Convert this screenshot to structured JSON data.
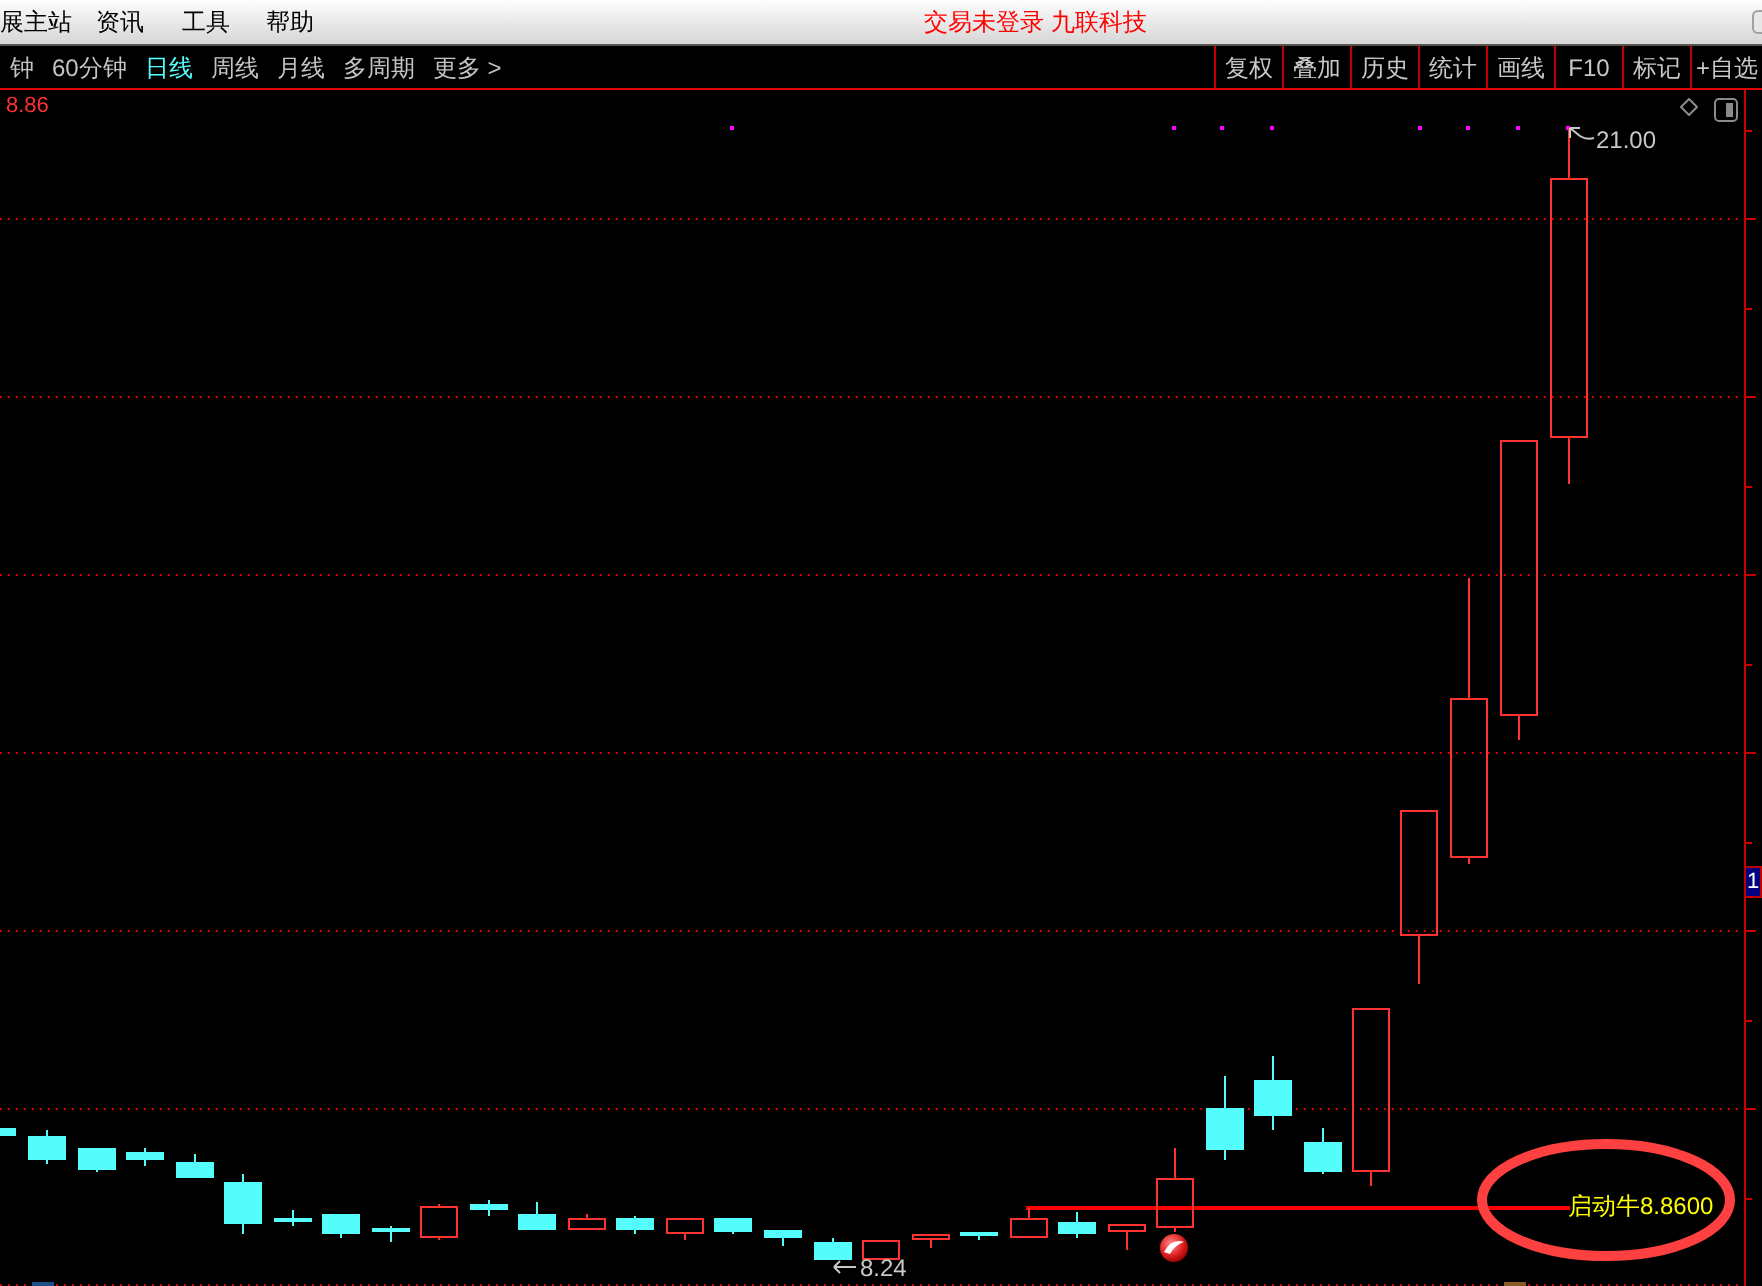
{
  "menu_bar": {
    "items": [
      "展主站",
      "资讯",
      "工具",
      "帮助"
    ],
    "status": "交易未登录 九联科技"
  },
  "period_tabs": [
    {
      "label": "钟",
      "selected": false
    },
    {
      "label": "60分钟",
      "selected": false
    },
    {
      "label": "日线",
      "selected": true
    },
    {
      "label": "周线",
      "selected": false
    },
    {
      "label": "月线",
      "selected": false
    },
    {
      "label": "多周期",
      "selected": false
    },
    {
      "label": "更多 >",
      "selected": false
    }
  ],
  "tools": [
    "复权",
    "叠加",
    "历史",
    "统计",
    "画线",
    "F10",
    "标记",
    "+自选"
  ],
  "chart": {
    "price_label": "8.86",
    "high_label": "21.00",
    "low_label": "8.24",
    "signal_label": "启动牛8.8600",
    "axis_marker": "1"
  }
}
